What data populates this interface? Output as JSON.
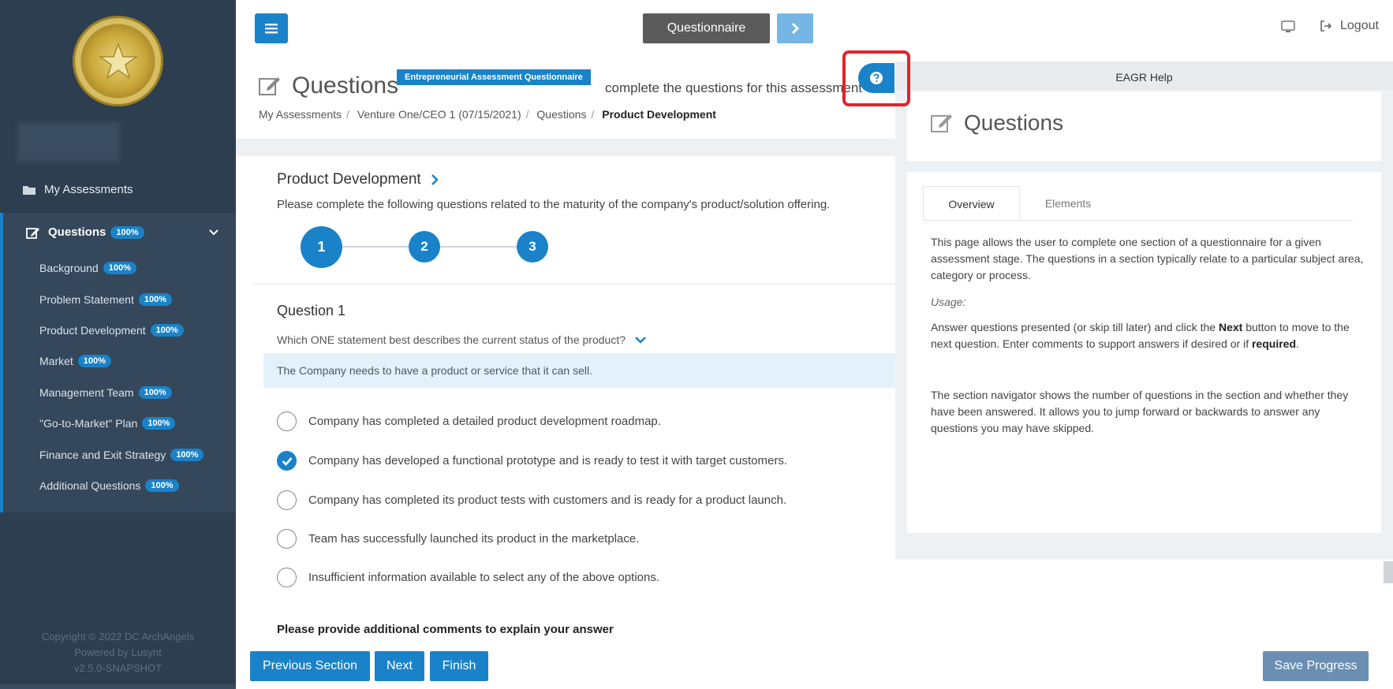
{
  "sidebar": {
    "copyright_lines": [
      "Copyright © 2022 DC ArchAngels",
      "Powered by Lusynt",
      "v2.5.0-SNAPSHOT"
    ],
    "my_assessments": "My Assessments",
    "questions": {
      "label": "Questions",
      "badge": "100%"
    },
    "items": [
      {
        "label": "Background",
        "badge": "100%"
      },
      {
        "label": "Problem Statement",
        "badge": "100%"
      },
      {
        "label": "Product Development",
        "badge": "100%"
      },
      {
        "label": "Market",
        "badge": "100%"
      },
      {
        "label": "Management Team",
        "badge": "100%"
      },
      {
        "label": "\"Go-to-Market\" Plan",
        "badge": "100%"
      },
      {
        "label": "Finance and Exit Strategy",
        "badge": "100%"
      },
      {
        "label": "Additional Questions",
        "badge": "100%"
      }
    ]
  },
  "topbar": {
    "questionnaire_label": "Questionnaire",
    "logout_label": "Logout"
  },
  "header": {
    "title": "Questions",
    "badge": "Entrepreneurial Assessment Questionnaire",
    "description": "complete the questions for this assessment",
    "breadcrumb": [
      "My Assessments",
      "Venture One/CEO 1 (07/15/2021)",
      "Questions",
      "Product Development"
    ]
  },
  "section": {
    "title": "Product Development",
    "description": "Please complete the following questions related to the maturity of the company's product/solution offering.",
    "steps": [
      "1",
      "2",
      "3"
    ],
    "question_title": "Question 1",
    "question_text": "Which ONE statement best describes the current status of the product?",
    "hint": "The Company needs to have a product or service that it can sell.",
    "options": [
      {
        "label": "Company has completed a detailed product development roadmap.",
        "checked": false
      },
      {
        "label": "Company has developed a functional prototype and is ready to test it with target customers.",
        "checked": true
      },
      {
        "label": "Company has completed its product tests with customers and is ready for a product launch.",
        "checked": false
      },
      {
        "label": "Team has successfully launched its product in the marketplace.",
        "checked": false
      },
      {
        "label": "Insufficient information available to select any of the above options.",
        "checked": false
      }
    ],
    "comments_label": "Please provide additional comments to explain your answer"
  },
  "bottom": {
    "previous": "Previous Section",
    "next": "Next",
    "finish": "Finish",
    "save": "Save Progress"
  },
  "help": {
    "header": "EAGR Help",
    "title": "Questions",
    "tabs": [
      "Overview",
      "Elements"
    ],
    "para1": "This page allows the user to complete one section of a questionnaire for a given assessment stage. The questions in a section typically relate to a particular subject area, category or process.",
    "usage_label": "Usage:",
    "para2_a": "Answer questions presented (or skip till later) and click the ",
    "para2_b": "Next",
    "para2_c": " button to move to the next question. Enter comments to support answers if desired or if ",
    "para2_d": "required",
    "para2_e": ".",
    "para3": "The section navigator shows the number of questions in the section and whether they have been answered. It allows you to jump forward or backwards to answer any questions you may have skipped."
  },
  "colors": {
    "accent": "#1a82c8",
    "sidebar": "#2d3e50",
    "highlight": "#e0242a"
  }
}
